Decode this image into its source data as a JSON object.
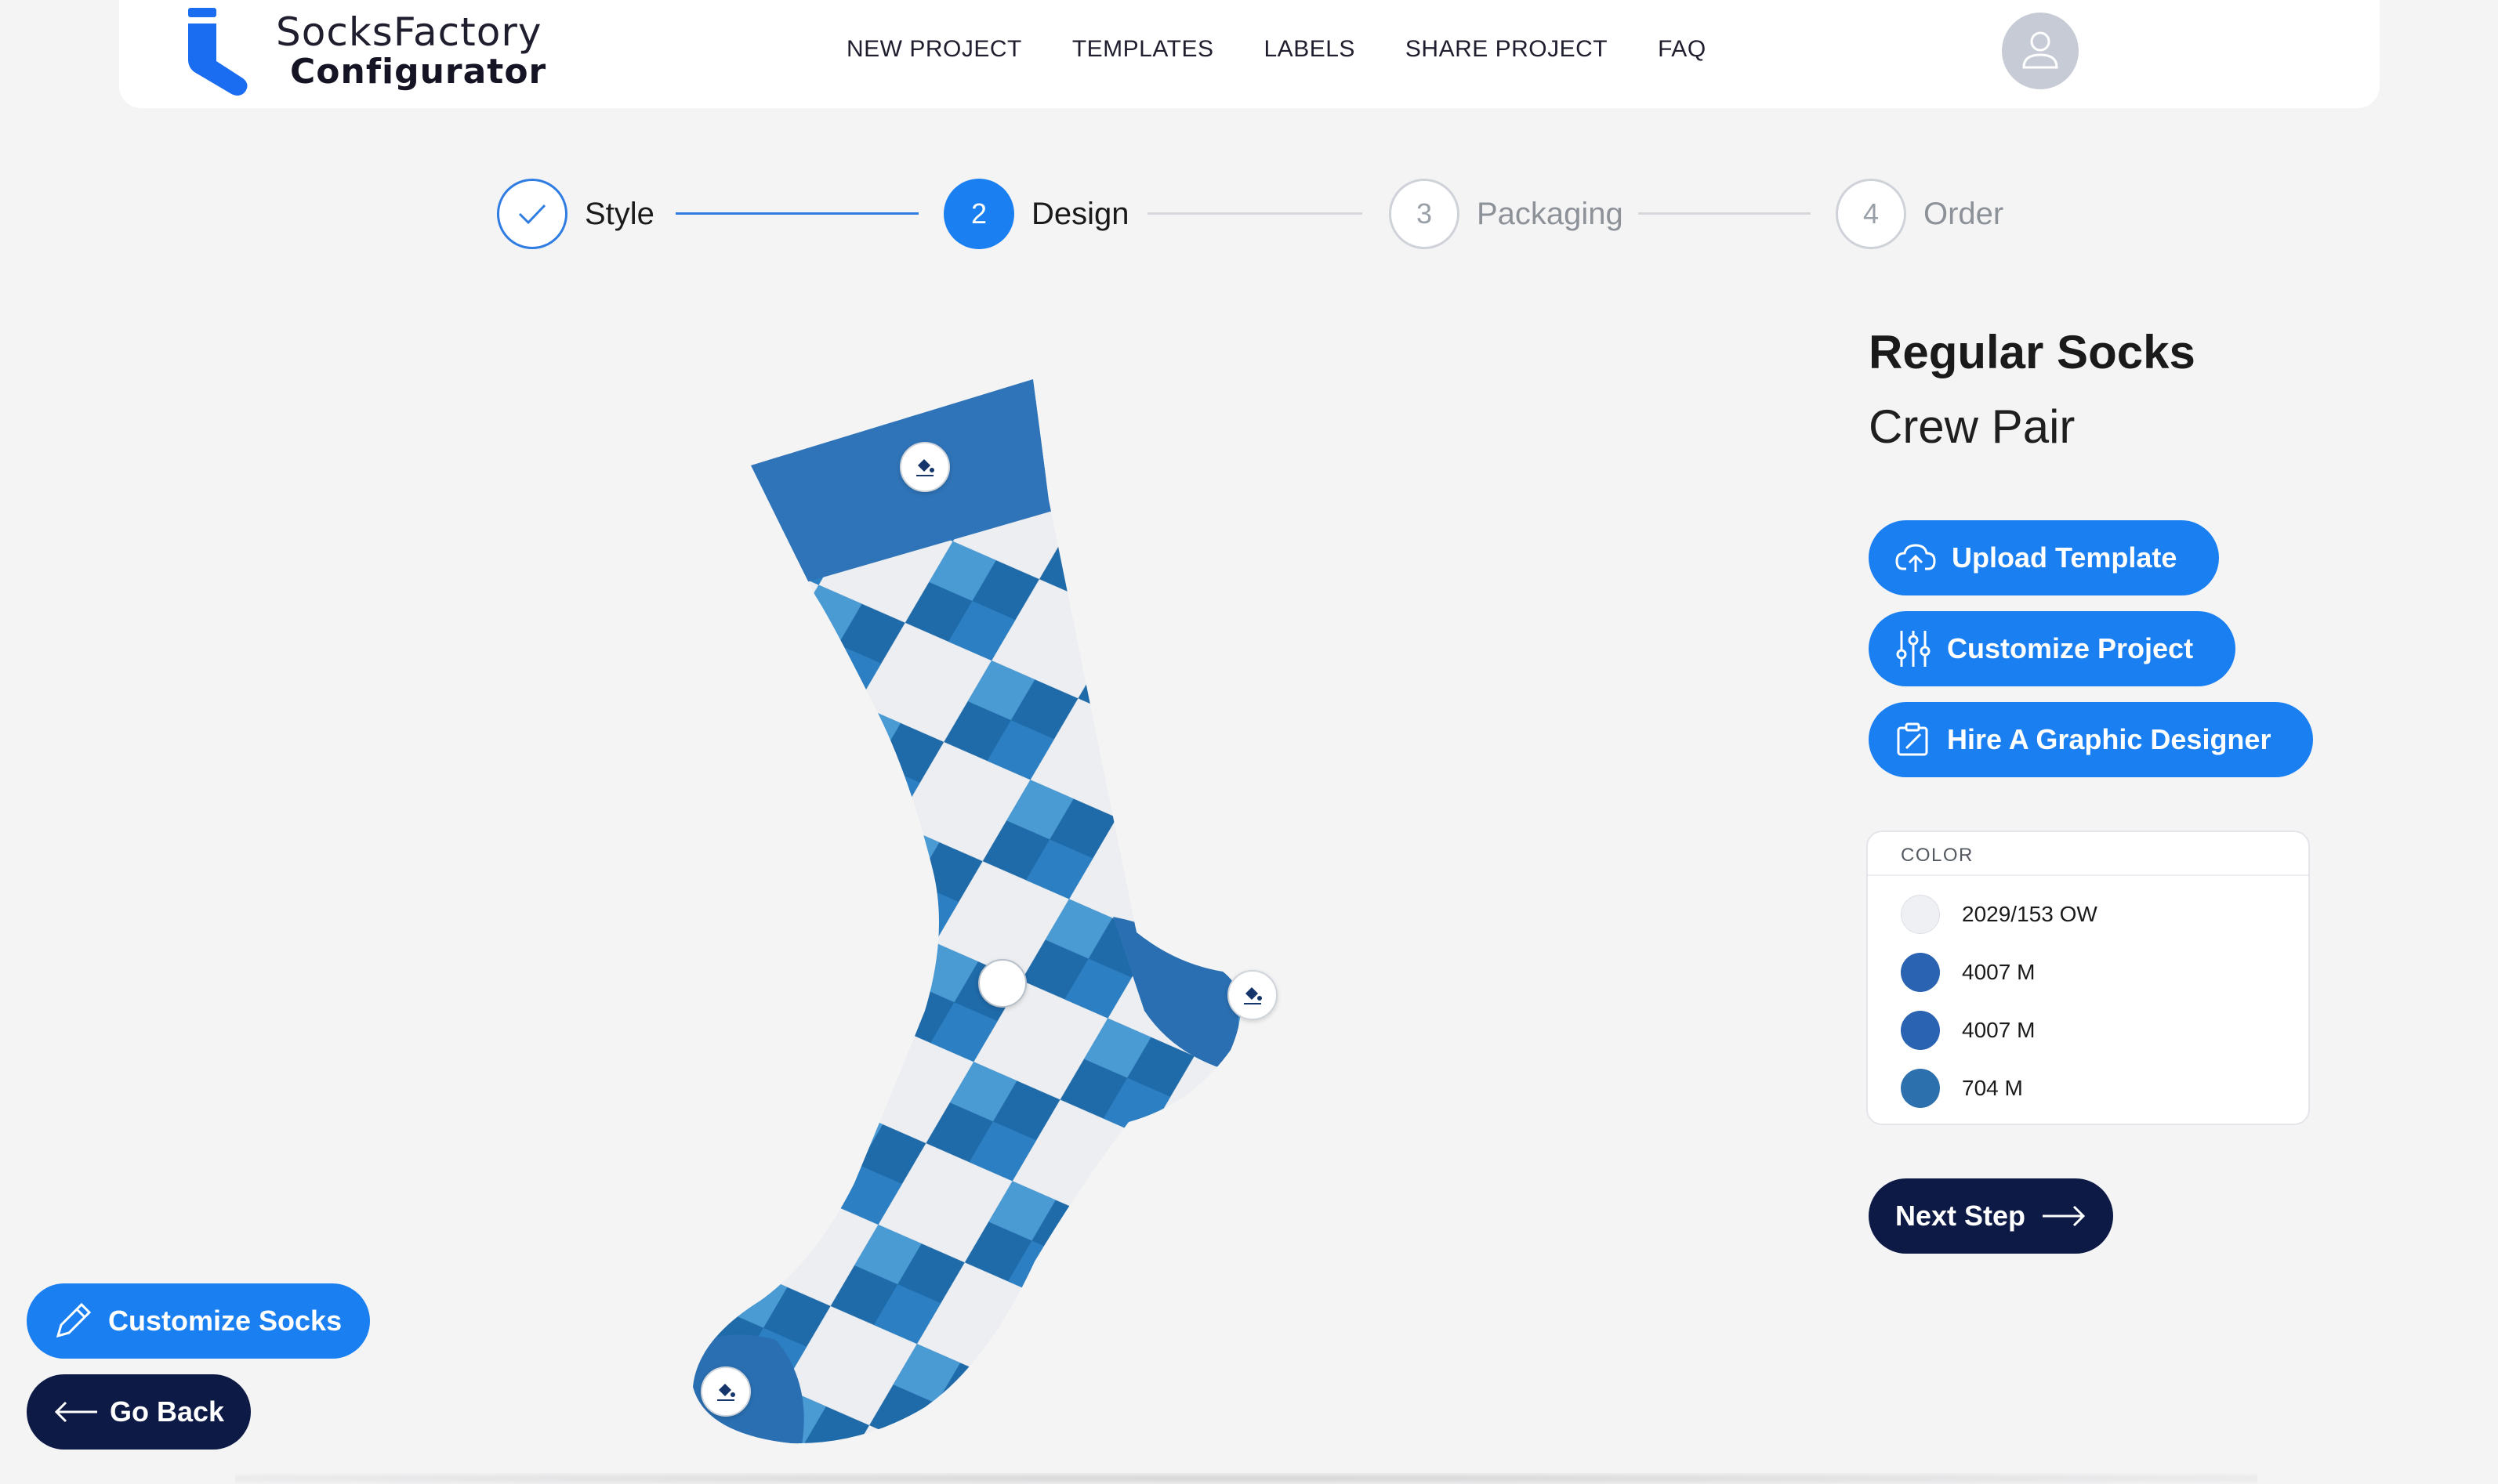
{
  "header": {
    "brand_line1": "SocksFactory",
    "brand_line2": "Configurator",
    "nav": [
      "NEW PROJECT",
      "TEMPLATES",
      "LABELS",
      "SHARE PROJECT",
      "FAQ"
    ]
  },
  "stepper": {
    "steps": [
      {
        "number": "1",
        "label": "Style",
        "state": "done"
      },
      {
        "number": "2",
        "label": "Design",
        "state": "active"
      },
      {
        "number": "3",
        "label": "Packaging",
        "state": "todo"
      },
      {
        "number": "4",
        "label": "Order",
        "state": "todo"
      }
    ]
  },
  "product": {
    "title": "Regular Socks",
    "subtitle": "Crew Pair"
  },
  "actions": {
    "upload_template": "Upload Template",
    "customize_project": "Customize Project",
    "hire_designer": "Hire A Graphic Designer"
  },
  "color_panel": {
    "header": "COLOR",
    "colors": [
      {
        "code": "2029/153 OW",
        "hex": "#eef0f3"
      },
      {
        "code": "4007 M",
        "hex": "#2b63b3"
      },
      {
        "code": "4007 M",
        "hex": "#2b63b3"
      },
      {
        "code": "704 M",
        "hex": "#2c70ad"
      }
    ]
  },
  "next_step_label": "Next Step",
  "customize_socks_label": "Customize Socks",
  "go_back_label": "Go Back",
  "theme": {
    "primary_blue": "#1a7ff0",
    "navy": "#0c1a45",
    "sock_dark": "#1f6aa8",
    "sock_mid": "#4a9ad4",
    "sock_light": "#eceef1"
  }
}
